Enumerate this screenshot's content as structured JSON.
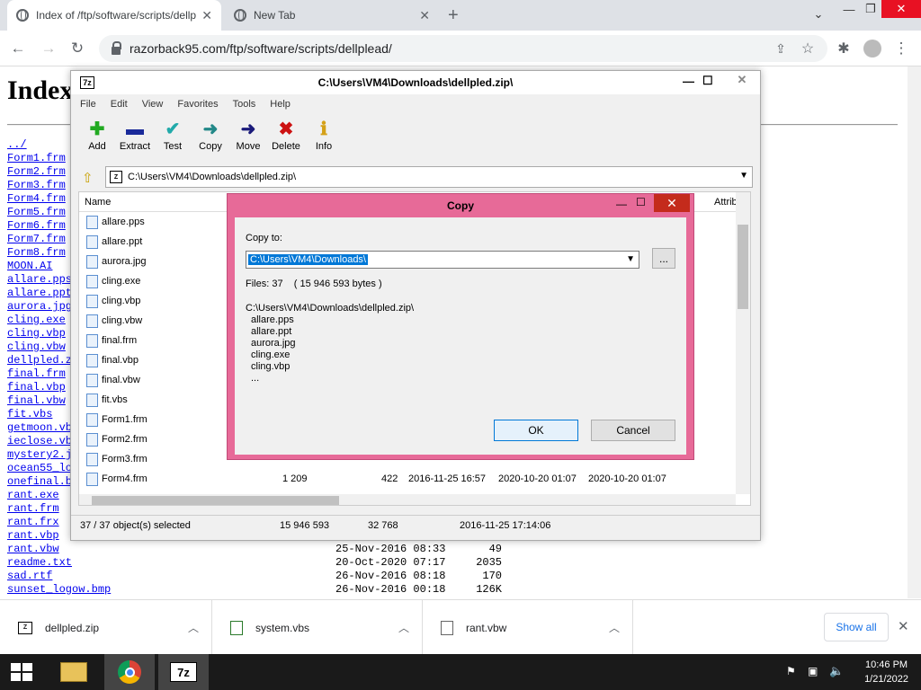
{
  "browser": {
    "tabs": [
      {
        "title": "Index of /ftp/software/scripts/dellpl"
      },
      {
        "title": "New Tab"
      }
    ],
    "url": "razorback95.com/ftp/software/scripts/dellplead/"
  },
  "page": {
    "heading": "Index",
    "left_links": [
      "../",
      "Form1.frm",
      "Form2.frm",
      "Form3.frm",
      "Form4.frm",
      "Form5.frm",
      "Form6.frm",
      "Form7.frm",
      "Form8.frm",
      "MOON.AI",
      "allare.pps",
      "allare.ppt",
      "aurora.jpg",
      "cling.exe",
      "cling.vbp",
      "cling.vbw",
      "dellpled.z",
      "final.frm",
      "final.vbp",
      "final.vbw",
      "fit.vbs",
      "getmoon.vb",
      "ieclose.vb",
      "mystery2.j",
      "ocean55_lo",
      "onefinal.b",
      "rant.exe",
      "rant.frm",
      "rant.frx",
      "rant.vbp"
    ],
    "bottom_rows": [
      {
        "name": "rant.vbw",
        "date": "25-Nov-2016 08:33",
        "size": "49"
      },
      {
        "name": "readme.txt",
        "date": "20-Oct-2020 07:17",
        "size": "2035"
      },
      {
        "name": "sad.rtf",
        "date": "26-Nov-2016 08:18",
        "size": "170"
      },
      {
        "name": "sunset_logow.bmp",
        "date": "26-Nov-2016 00:18",
        "size": "126K"
      }
    ]
  },
  "sevenzip": {
    "title": "C:\\Users\\VM4\\Downloads\\dellpled.zip\\",
    "menu": [
      "File",
      "Edit",
      "View",
      "Favorites",
      "Tools",
      "Help"
    ],
    "toolbar": [
      {
        "label": "Add",
        "glyph": "✚",
        "color": "#22aa22"
      },
      {
        "label": "Extract",
        "glyph": "▬",
        "color": "#1a2a9a"
      },
      {
        "label": "Test",
        "glyph": "✔",
        "color": "#22aaaa"
      },
      {
        "label": "Copy",
        "glyph": "➜",
        "color": "#228888"
      },
      {
        "label": "Move",
        "glyph": "➜",
        "color": "#1a1a7a"
      },
      {
        "label": "Delete",
        "glyph": "✖",
        "color": "#cc1111"
      },
      {
        "label": "Info",
        "glyph": "ℹ",
        "color": "#d4a017"
      }
    ],
    "address": "C:\\Users\\VM4\\Downloads\\dellpled.zip\\",
    "columns": {
      "name": "Name",
      "attrib": "Attrib"
    },
    "files": [
      "allare.pps",
      "allare.ppt",
      "aurora.jpg",
      "cling.exe",
      "cling.vbp",
      "cling.vbw",
      "final.frm",
      "final.vbp",
      "final.vbw",
      "fit.vbs",
      "Form1.frm",
      "Form2.frm",
      "Form3.frm",
      "Form4.frm"
    ],
    "form4_row": {
      "size": "1 209",
      "packed": "422",
      "modified": "2016-11-25 16:57",
      "created": "2020-10-20 01:07",
      "accessed": "2020-10-20 01:07"
    },
    "status": {
      "selected": "37 / 37 object(s) selected",
      "size": "15 946 593",
      "packed": "32 768",
      "date": "2016-11-25 17:14:06"
    }
  },
  "copy_dialog": {
    "title": "Copy",
    "copy_to_label": "Copy to:",
    "path": "C:\\Users\\VM4\\Downloads\\",
    "browse": "...",
    "files_info": "Files: 37    ( 15 946 593 bytes )",
    "source": "C:\\Users\\VM4\\Downloads\\dellpled.zip\\",
    "items": [
      "allare.pps",
      "allare.ppt",
      "aurora.jpg",
      "cling.exe",
      "cling.vbp",
      "..."
    ],
    "ok": "OK",
    "cancel": "Cancel"
  },
  "downloads": {
    "items": [
      "dellpled.zip",
      "system.vbs",
      "rant.vbw"
    ],
    "show_all": "Show all"
  },
  "taskbar": {
    "time": "10:46 PM",
    "date": "1/21/2022"
  }
}
